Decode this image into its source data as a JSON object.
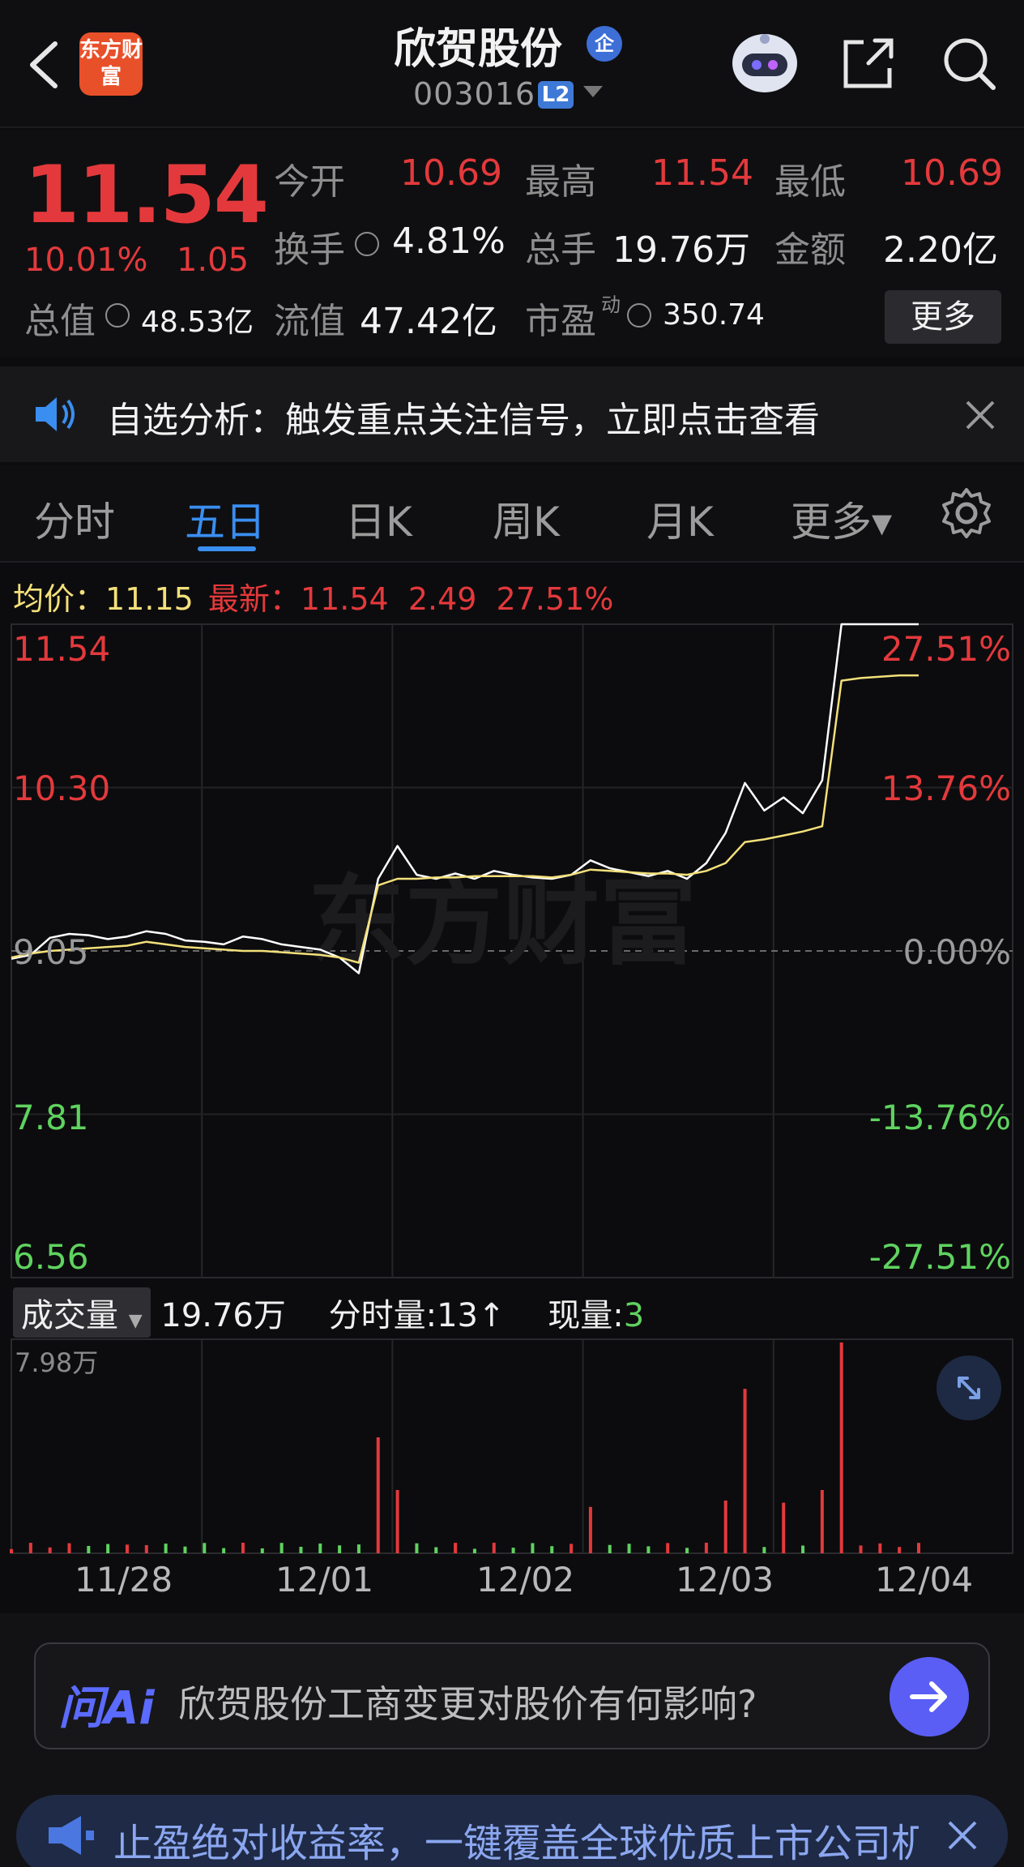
{
  "header": {
    "logo_text": "东方财富",
    "stock_name": "欣贺股份",
    "ent_badge": "企",
    "stock_code": "003016",
    "level_badge": "L2"
  },
  "quote": {
    "price": "11.54",
    "change_pct": "10.01%",
    "change_abs": "1.05",
    "fields": {
      "open_label": "今开",
      "open": "10.69",
      "high_label": "最高",
      "high": "11.54",
      "low_label": "最低",
      "low": "10.69",
      "turnover_label": "换手",
      "turnover": "4.81%",
      "volume_label": "总手",
      "volume": "19.76万",
      "amount_label": "金额",
      "amount": "2.20亿",
      "mktcap_label": "总值",
      "mktcap": "48.53亿",
      "float_label": "流值",
      "float": "47.42亿",
      "pe_label": "市盈",
      "pe_sup": "动",
      "pe": "350.74"
    },
    "more_label": "更多"
  },
  "notice": {
    "text": "自选分析：触发重点关注信号，立即点击查看"
  },
  "tabs": [
    {
      "label": "分时",
      "active": false
    },
    {
      "label": "五日",
      "active": true
    },
    {
      "label": "日K",
      "active": false
    },
    {
      "label": "周K",
      "active": false
    },
    {
      "label": "月K",
      "active": false
    },
    {
      "label": "更多▾",
      "active": false
    }
  ],
  "chart_header": {
    "avg_label": "均价：",
    "avg_value": "11.15",
    "latest_label": "最新：",
    "latest_value": "11.54",
    "latest_change": "2.49",
    "latest_pct": "27.51%"
  },
  "chart_data": {
    "type": "line",
    "title": "",
    "y_left_ticks": [
      "11.54",
      "10.30",
      "9.05",
      "7.81",
      "6.56"
    ],
    "y_right_ticks": [
      "27.51%",
      "13.76%",
      "0.00%",
      "-13.76%",
      "-27.51%"
    ],
    "ylim": [
      6.56,
      11.54
    ],
    "baseline": 9.05,
    "x_days": [
      "11/28",
      "12/01",
      "12/02",
      "12/03",
      "12/04"
    ],
    "series": [
      {
        "name": "",
        "color": "#ffffff",
        "values": [
          8.99,
          9.02,
          9.15,
          9.18,
          9.17,
          9.14,
          9.16,
          9.2,
          9.18,
          9.13,
          9.12,
          9.1,
          9.16,
          9.14,
          9.1,
          9.08,
          9.06,
          9.0,
          8.88,
          9.6,
          9.85,
          9.63,
          9.6,
          9.64,
          9.6,
          9.66,
          9.63,
          9.61,
          9.6,
          9.63,
          9.74,
          9.68,
          9.65,
          9.62,
          9.66,
          9.6,
          9.72,
          9.95,
          10.33,
          10.12,
          10.22,
          10.1,
          10.35,
          11.54,
          11.54,
          11.54,
          11.54,
          11.54
        ]
      },
      {
        "name": "",
        "color": "#f3e07a",
        "values": [
          9.0,
          9.03,
          9.05,
          9.06,
          9.07,
          9.08,
          9.09,
          9.12,
          9.1,
          9.08,
          9.07,
          9.06,
          9.05,
          9.05,
          9.04,
          9.03,
          9.02,
          9.0,
          8.96,
          9.55,
          9.6,
          9.6,
          9.61,
          9.61,
          9.62,
          9.62,
          9.62,
          9.62,
          9.61,
          9.63,
          9.67,
          9.66,
          9.65,
          9.64,
          9.64,
          9.63,
          9.66,
          9.72,
          9.88,
          9.9,
          9.93,
          9.96,
          10.0,
          11.11,
          11.13,
          11.14,
          11.15,
          11.15
        ]
      }
    ]
  },
  "volume": {
    "select_label": "成交量",
    "total": "19.76万",
    "tick_label": "分时量:",
    "tick_value": "13",
    "current_label": "现量:",
    "current_value": "3",
    "max_label": "7.98万",
    "max": 79800
  },
  "watermark": "东方财富",
  "ai": {
    "logo": "问Ai",
    "question": "欣贺股份工商变更对股价有何影响?"
  },
  "ticker": {
    "text": "止盈绝对收益率，一键覆盖全球优质上市公司机会"
  },
  "colors": {
    "up": "#e4393c",
    "down": "#5fd35f",
    "accent": "#3a8ef0",
    "avg_line": "#f3e07a"
  }
}
